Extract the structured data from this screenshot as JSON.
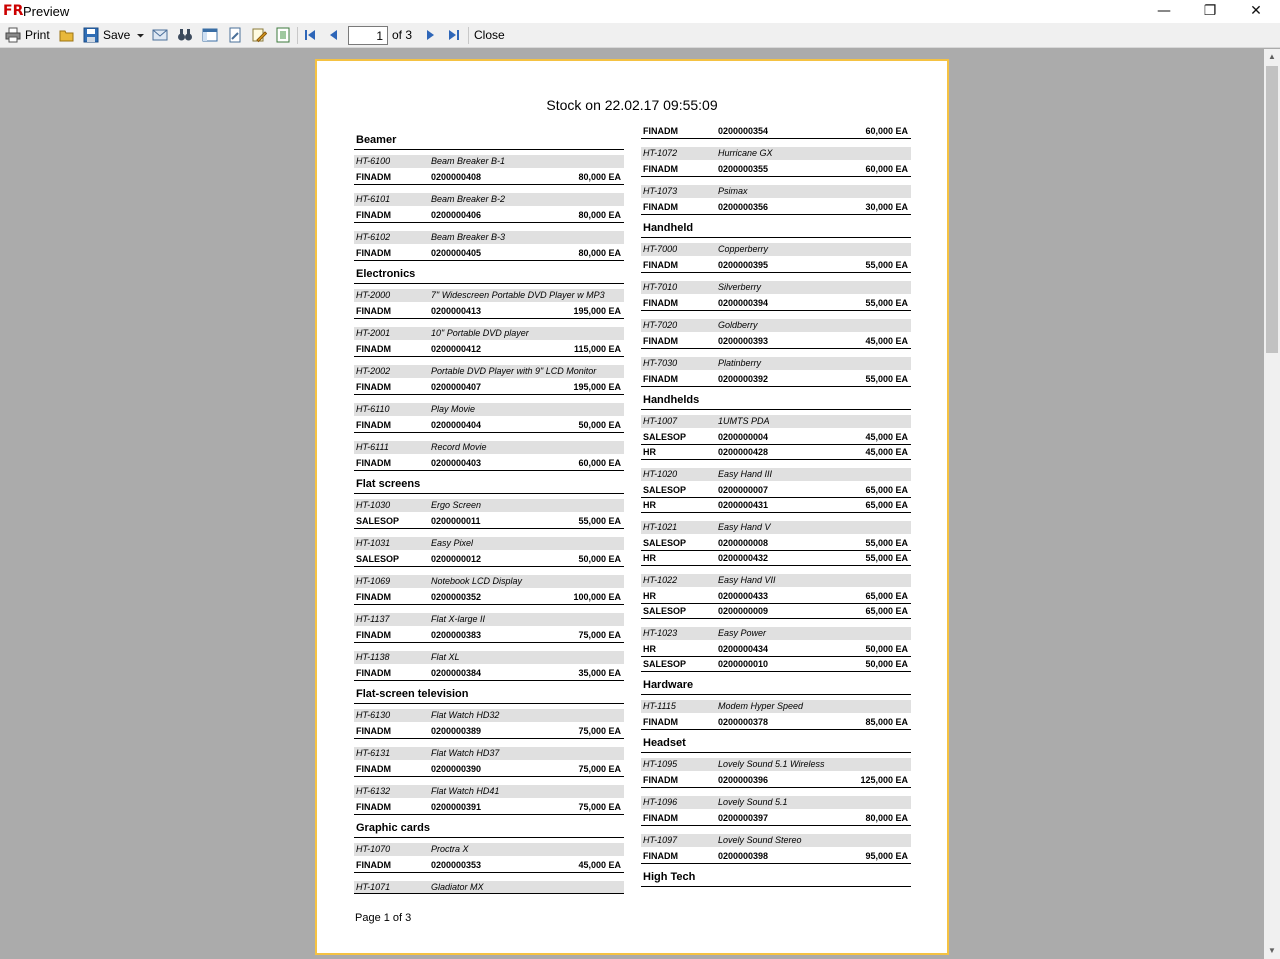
{
  "window": {
    "title": "Preview",
    "logo": "FR"
  },
  "toolbar": {
    "print_label": "Print",
    "save_label": "Save",
    "page_value": "1",
    "page_of": "of 3",
    "close_label": "Close"
  },
  "report": {
    "title": "Stock on 22.02.17 09:55:09",
    "footer": "Page 1 of 3",
    "columns": [
      {
        "items": [
          {
            "kind": "group",
            "label": "Beamer"
          },
          {
            "kind": "product",
            "id": "HT-6100",
            "name": "Beam Breaker B-1"
          },
          {
            "kind": "stock",
            "org": "FINADM",
            "code": "0200000408",
            "qty": "80,000 EA"
          },
          {
            "kind": "product",
            "id": "HT-6101",
            "name": "Beam Breaker B-2"
          },
          {
            "kind": "stock",
            "org": "FINADM",
            "code": "0200000406",
            "qty": "80,000 EA"
          },
          {
            "kind": "product",
            "id": "HT-6102",
            "name": "Beam Breaker B-3"
          },
          {
            "kind": "stock",
            "org": "FINADM",
            "code": "0200000405",
            "qty": "80,000 EA"
          },
          {
            "kind": "group",
            "label": "Electronics"
          },
          {
            "kind": "product",
            "id": "HT-2000",
            "name": "7\" Widescreen Portable DVD Player w MP3"
          },
          {
            "kind": "stock",
            "org": "FINADM",
            "code": "0200000413",
            "qty": "195,000 EA"
          },
          {
            "kind": "product",
            "id": "HT-2001",
            "name": "10\" Portable DVD player"
          },
          {
            "kind": "stock",
            "org": "FINADM",
            "code": "0200000412",
            "qty": "115,000 EA"
          },
          {
            "kind": "product",
            "id": "HT-2002",
            "name": "Portable DVD Player with 9\" LCD Monitor"
          },
          {
            "kind": "stock",
            "org": "FINADM",
            "code": "0200000407",
            "qty": "195,000 EA"
          },
          {
            "kind": "product",
            "id": "HT-6110",
            "name": "Play Movie"
          },
          {
            "kind": "stock",
            "org": "FINADM",
            "code": "0200000404",
            "qty": "50,000 EA"
          },
          {
            "kind": "product",
            "id": "HT-6111",
            "name": "Record Movie"
          },
          {
            "kind": "stock",
            "org": "FINADM",
            "code": "0200000403",
            "qty": "60,000 EA"
          },
          {
            "kind": "group",
            "label": "Flat screens"
          },
          {
            "kind": "product",
            "id": "HT-1030",
            "name": "Ergo Screen"
          },
          {
            "kind": "stock",
            "org": "SALESOP",
            "code": "0200000011",
            "qty": "55,000 EA"
          },
          {
            "kind": "product",
            "id": "HT-1031",
            "name": "Easy Pixel"
          },
          {
            "kind": "stock",
            "org": "SALESOP",
            "code": "0200000012",
            "qty": "50,000 EA"
          },
          {
            "kind": "product",
            "id": "HT-1069",
            "name": "Notebook LCD Display"
          },
          {
            "kind": "stock",
            "org": "FINADM",
            "code": "0200000352",
            "qty": "100,000 EA"
          },
          {
            "kind": "product",
            "id": "HT-1137",
            "name": "Flat X-large II"
          },
          {
            "kind": "stock",
            "org": "FINADM",
            "code": "0200000383",
            "qty": "75,000 EA"
          },
          {
            "kind": "product",
            "id": "HT-1138",
            "name": "Flat XL"
          },
          {
            "kind": "stock",
            "org": "FINADM",
            "code": "0200000384",
            "qty": "35,000 EA"
          },
          {
            "kind": "group",
            "label": "Flat-screen television"
          },
          {
            "kind": "product",
            "id": "HT-6130",
            "name": "Flat Watch HD32"
          },
          {
            "kind": "stock",
            "org": "FINADM",
            "code": "0200000389",
            "qty": "75,000 EA"
          },
          {
            "kind": "product",
            "id": "HT-6131",
            "name": "Flat Watch HD37"
          },
          {
            "kind": "stock",
            "org": "FINADM",
            "code": "0200000390",
            "qty": "75,000 EA"
          },
          {
            "kind": "product",
            "id": "HT-6132",
            "name": "Flat Watch HD41"
          },
          {
            "kind": "stock",
            "org": "FINADM",
            "code": "0200000391",
            "qty": "75,000 EA"
          },
          {
            "kind": "group",
            "label": "Graphic cards"
          },
          {
            "kind": "product",
            "id": "HT-1070",
            "name": "Proctra X"
          },
          {
            "kind": "stock",
            "org": "FINADM",
            "code": "0200000353",
            "qty": "45,000 EA"
          },
          {
            "kind": "product",
            "id": "HT-1071",
            "name": "Gladiator MX",
            "last": true
          }
        ]
      },
      {
        "items": [
          {
            "kind": "stock",
            "org": "FINADM",
            "code": "0200000354",
            "qty": "60,000 EA"
          },
          {
            "kind": "product",
            "id": "HT-1072",
            "name": "Hurricane GX"
          },
          {
            "kind": "stock",
            "org": "FINADM",
            "code": "0200000355",
            "qty": "60,000 EA"
          },
          {
            "kind": "product",
            "id": "HT-1073",
            "name": "Psimax"
          },
          {
            "kind": "stock",
            "org": "FINADM",
            "code": "0200000356",
            "qty": "30,000 EA"
          },
          {
            "kind": "group",
            "label": "Handheld"
          },
          {
            "kind": "product",
            "id": "HT-7000",
            "name": "Copperberry"
          },
          {
            "kind": "stock",
            "org": "FINADM",
            "code": "0200000395",
            "qty": "55,000 EA"
          },
          {
            "kind": "product",
            "id": "HT-7010",
            "name": "Silverberry"
          },
          {
            "kind": "stock",
            "org": "FINADM",
            "code": "0200000394",
            "qty": "55,000 EA"
          },
          {
            "kind": "product",
            "id": "HT-7020",
            "name": "Goldberry"
          },
          {
            "kind": "stock",
            "org": "FINADM",
            "code": "0200000393",
            "qty": "45,000 EA"
          },
          {
            "kind": "product",
            "id": "HT-7030",
            "name": "Platinberry"
          },
          {
            "kind": "stock",
            "org": "FINADM",
            "code": "0200000392",
            "qty": "55,000 EA"
          },
          {
            "kind": "group",
            "label": "Handhelds"
          },
          {
            "kind": "product",
            "id": "HT-1007",
            "name": "1UMTS PDA"
          },
          {
            "kind": "stock",
            "org": "SALESOP",
            "code": "0200000004",
            "qty": "45,000 EA"
          },
          {
            "kind": "stock",
            "org": "HR",
            "code": "0200000428",
            "qty": "45,000 EA"
          },
          {
            "kind": "product",
            "id": "HT-1020",
            "name": "Easy Hand III"
          },
          {
            "kind": "stock",
            "org": "SALESOP",
            "code": "0200000007",
            "qty": "65,000 EA"
          },
          {
            "kind": "stock",
            "org": "HR",
            "code": "0200000431",
            "qty": "65,000 EA"
          },
          {
            "kind": "product",
            "id": "HT-1021",
            "name": "Easy Hand V"
          },
          {
            "kind": "stock",
            "org": "SALESOP",
            "code": "0200000008",
            "qty": "55,000 EA"
          },
          {
            "kind": "stock",
            "org": "HR",
            "code": "0200000432",
            "qty": "55,000 EA"
          },
          {
            "kind": "product",
            "id": "HT-1022",
            "name": "Easy Hand VII"
          },
          {
            "kind": "stock",
            "org": "HR",
            "code": "0200000433",
            "qty": "65,000 EA"
          },
          {
            "kind": "stock",
            "org": "SALESOP",
            "code": "0200000009",
            "qty": "65,000 EA"
          },
          {
            "kind": "product",
            "id": "HT-1023",
            "name": "Easy Power"
          },
          {
            "kind": "stock",
            "org": "HR",
            "code": "0200000434",
            "qty": "50,000 EA"
          },
          {
            "kind": "stock",
            "org": "SALESOP",
            "code": "0200000010",
            "qty": "50,000 EA"
          },
          {
            "kind": "group",
            "label": "Hardware"
          },
          {
            "kind": "product",
            "id": "HT-1115",
            "name": "Modem Hyper Speed"
          },
          {
            "kind": "stock",
            "org": "FINADM",
            "code": "0200000378",
            "qty": "85,000 EA"
          },
          {
            "kind": "group",
            "label": "Headset"
          },
          {
            "kind": "product",
            "id": "HT-1095",
            "name": "Lovely Sound 5.1 Wireless"
          },
          {
            "kind": "stock",
            "org": "FINADM",
            "code": "0200000396",
            "qty": "125,000 EA"
          },
          {
            "kind": "product",
            "id": "HT-1096",
            "name": "Lovely Sound 5.1"
          },
          {
            "kind": "stock",
            "org": "FINADM",
            "code": "0200000397",
            "qty": "80,000 EA"
          },
          {
            "kind": "product",
            "id": "HT-1097",
            "name": "Lovely Sound Stereo"
          },
          {
            "kind": "stock",
            "org": "FINADM",
            "code": "0200000398",
            "qty": "95,000 EA"
          },
          {
            "kind": "group",
            "label": "High Tech"
          }
        ]
      }
    ]
  }
}
